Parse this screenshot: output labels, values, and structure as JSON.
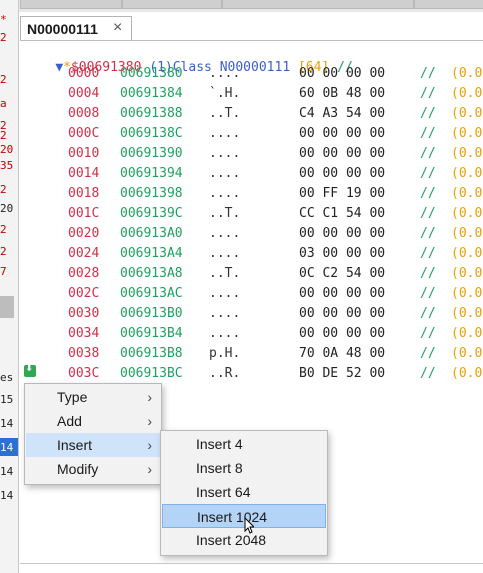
{
  "document_tab": {
    "title": "N00000111",
    "close_glyph": "×"
  },
  "header": {
    "arrow": "▼",
    "marker": "*",
    "address": "$00691380",
    "index": "(1)",
    "keyword": "Class",
    "class_name": "N00000111",
    "size": "[64]",
    "comment": "//"
  },
  "rows": [
    {
      "offset": "0000",
      "address": "00691380",
      "text": "....",
      "hex": "00 00 00 00",
      "comment": "//",
      "value": "(0.0"
    },
    {
      "offset": "0004",
      "address": "00691384",
      "text": "`.H.",
      "hex": "60 0B 48 00",
      "comment": "//",
      "value": "(0.0"
    },
    {
      "offset": "0008",
      "address": "00691388",
      "text": "..T.",
      "hex": "C4 A3 54 00",
      "comment": "//",
      "value": "(0.0"
    },
    {
      "offset": "000C",
      "address": "0069138C",
      "text": "....",
      "hex": "00 00 00 00",
      "comment": "//",
      "value": "(0.0"
    },
    {
      "offset": "0010",
      "address": "00691390",
      "text": "....",
      "hex": "00 00 00 00",
      "comment": "//",
      "value": "(0.0"
    },
    {
      "offset": "0014",
      "address": "00691394",
      "text": "....",
      "hex": "00 00 00 00",
      "comment": "//",
      "value": "(0.0"
    },
    {
      "offset": "0018",
      "address": "00691398",
      "text": "....",
      "hex": "00 FF 19 00",
      "comment": "//",
      "value": "(0.0"
    },
    {
      "offset": "001C",
      "address": "0069139C",
      "text": "..T.",
      "hex": "CC C1 54 00",
      "comment": "//",
      "value": "(0.0"
    },
    {
      "offset": "0020",
      "address": "006913A0",
      "text": "....",
      "hex": "00 00 00 00",
      "comment": "//",
      "value": "(0.0"
    },
    {
      "offset": "0024",
      "address": "006913A4",
      "text": "....",
      "hex": "03 00 00 00",
      "comment": "//",
      "value": "(0.0"
    },
    {
      "offset": "0028",
      "address": "006913A8",
      "text": "..T.",
      "hex": "0C C2 54 00",
      "comment": "//",
      "value": "(0.0"
    },
    {
      "offset": "002C",
      "address": "006913AC",
      "text": "....",
      "hex": "00 00 00 00",
      "comment": "//",
      "value": "(0.0"
    },
    {
      "offset": "0030",
      "address": "006913B0",
      "text": "....",
      "hex": "00 00 00 00",
      "comment": "//",
      "value": "(0.0"
    },
    {
      "offset": "0034",
      "address": "006913B4",
      "text": "....",
      "hex": "00 00 00 00",
      "comment": "//",
      "value": "(0.0"
    },
    {
      "offset": "0038",
      "address": "006913B8",
      "text": "p.H.",
      "hex": "70 0A 48 00",
      "comment": "//",
      "value": "(0.0"
    },
    {
      "offset": "003C",
      "address": "006913BC",
      "text": "..R.",
      "hex": "B0 DE 52 00",
      "comment": "//",
      "value": "(0.0"
    }
  ],
  "context_menu": {
    "items": [
      {
        "label": "Type",
        "chevron": "›"
      },
      {
        "label": "Add",
        "chevron": "›"
      },
      {
        "label": "Insert",
        "chevron": "›"
      },
      {
        "label": "Modify",
        "chevron": "›"
      }
    ],
    "highlighted_index": 2
  },
  "insert_submenu": {
    "items": [
      "Insert 4",
      "Insert 8",
      "Insert 64",
      "Insert 1024",
      "Insert 2048"
    ],
    "selected_index": 3
  },
  "left_panel_fragments": [
    "*",
    "2",
    "2",
    "a",
    "2",
    "2",
    "20",
    "35",
    "2",
    "20",
    "2",
    "2",
    "2",
    "7",
    "es",
    "15",
    "14",
    "14",
    "14",
    "14"
  ],
  "colors": {
    "offset": "#d0304a",
    "address": "#20a060",
    "keyword": "#3a5fcd",
    "size": "#e8a000",
    "menu_bg": "#f2f2f2",
    "menu_highlight": "#cfe3fa",
    "submenu_selected": "#b3d3f7",
    "selection_blue": "#2c6fd6"
  }
}
